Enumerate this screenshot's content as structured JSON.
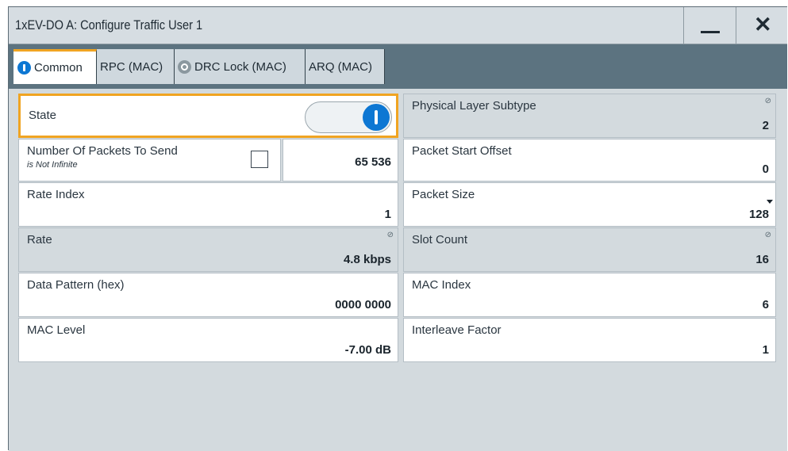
{
  "window": {
    "title": "1xEV-DO A: Configure Traffic User 1",
    "minimize_icon": "minimize-icon",
    "close_icon": "close-icon"
  },
  "tabs": [
    {
      "label": "Common",
      "icon": "on-indicator-icon",
      "active": true
    },
    {
      "label": "RPC (MAC)",
      "active": false
    },
    {
      "label": "DRC Lock (MAC)",
      "icon": "off-indicator-icon",
      "active": false
    },
    {
      "label": "ARQ (MAC)",
      "active": false
    }
  ],
  "fields": {
    "state": {
      "label": "State",
      "value": "On"
    },
    "physical_layer_subtype": {
      "label": "Physical Layer Subtype",
      "value": "2",
      "read_only": true
    },
    "num_packets": {
      "label": "Number Of Packets To Send",
      "sublabel": "is Not Infinite",
      "infinite_checked": false,
      "value": "65 536"
    },
    "packet_start_offset": {
      "label": "Packet Start Offset",
      "value": "0"
    },
    "rate_index": {
      "label": "Rate Index",
      "value": "1"
    },
    "packet_size": {
      "label": "Packet Size",
      "value": "128"
    },
    "rate": {
      "label": "Rate",
      "value": "4.8 kbps",
      "read_only": true
    },
    "slot_count": {
      "label": "Slot Count",
      "value": "16",
      "read_only": true
    },
    "data_pattern": {
      "label": "Data Pattern (hex)",
      "value": "0000 0000"
    },
    "mac_index": {
      "label": "MAC Index",
      "value": "6"
    },
    "mac_level": {
      "label": "MAC Level",
      "value": "-7.00 dB"
    },
    "interleave_factor": {
      "label": "Interleave Factor",
      "value": "1"
    }
  },
  "colors": {
    "accent": "#f0a422",
    "toggle_on": "#0d77d3",
    "tab_bar": "#5c7380",
    "read_only_bg": "#d3dade"
  }
}
